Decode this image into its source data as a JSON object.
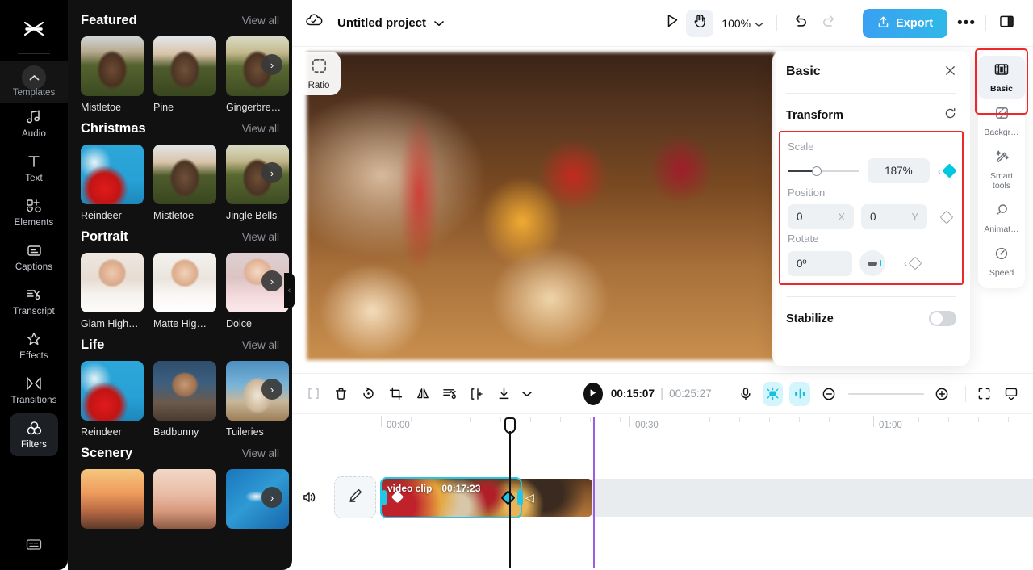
{
  "left_rail": {
    "logo_name": "capcut-logo",
    "templates": {
      "label": "Templates",
      "icon": "chevron-up-icon"
    },
    "items": [
      {
        "label": "Audio",
        "icon": "music-note-icon",
        "active": false
      },
      {
        "label": "Text",
        "icon": "text-t-icon",
        "active": false
      },
      {
        "label": "Elements",
        "icon": "shapes-plus-icon",
        "active": false
      },
      {
        "label": "Captions",
        "icon": "captions-icon",
        "active": false
      },
      {
        "label": "Transcript",
        "icon": "transcript-scissors-icon",
        "active": false
      },
      {
        "label": "Effects",
        "icon": "sparkle-star-icon",
        "active": false
      },
      {
        "label": "Transitions",
        "icon": "transitions-icon",
        "active": false
      },
      {
        "label": "Filters",
        "icon": "filters-circles-icon",
        "active": true
      }
    ],
    "bottom_icon": "keyboard-shortcuts-icon"
  },
  "templates_panel": {
    "view_all_label": "View all",
    "sections": [
      {
        "title": "Featured",
        "cards": [
          {
            "label": "Mistletoe",
            "art": "art-woman"
          },
          {
            "label": "Pine",
            "art": "art-woman2"
          },
          {
            "label": "Gingerbre…",
            "art": "art-woman3"
          }
        ]
      },
      {
        "title": "Christmas",
        "cards": [
          {
            "label": "Reindeer",
            "art": "art-santa"
          },
          {
            "label": "Mistletoe",
            "art": "art-woman2"
          },
          {
            "label": "Jingle Bells",
            "art": "art-woman3"
          }
        ]
      },
      {
        "title": "Portrait",
        "cards": [
          {
            "label": "Glam High…",
            "art": "art-glam"
          },
          {
            "label": "Matte Hig…",
            "art": "art-matte"
          },
          {
            "label": "Dolce",
            "art": "art-dolce"
          }
        ]
      },
      {
        "title": "Life",
        "cards": [
          {
            "label": "Reindeer",
            "art": "art-santa"
          },
          {
            "label": "Badbunny",
            "art": "art-badbunny"
          },
          {
            "label": "Tuileries",
            "art": "art-tuileries"
          }
        ]
      },
      {
        "title": "Scenery",
        "cards": [
          {
            "label": "",
            "art": "art-sunset"
          },
          {
            "label": "",
            "art": "art-tower"
          },
          {
            "label": "",
            "art": "art-pool"
          }
        ]
      }
    ]
  },
  "topbar": {
    "cloud_icon": "cloud-check-icon",
    "project_title": "Untitled project",
    "project_caret": "chevron-down-icon",
    "select_tool_icon": "cursor-arrow-icon",
    "hand_tool_icon": "hand-icon",
    "zoom_level": "100%",
    "undo_icon": "undo-icon",
    "redo_icon": "redo-icon",
    "export_label": "Export",
    "export_icon": "upload-icon",
    "more_label": "•••",
    "layout_icon": "split-layout-icon",
    "accent_color": "#2fb8e8"
  },
  "stage": {
    "ratio_label": "Ratio",
    "ratio_icon": "crop-dashed-icon",
    "collapse_icon": "chevron-left-icon"
  },
  "properties": {
    "title": "Basic",
    "close_icon": "close-icon",
    "transform_label": "Transform",
    "reset_icon": "reset-arrow-icon",
    "scale": {
      "label": "Scale",
      "value": "187%",
      "keyframe": "filled-diamond-icon",
      "prev_icon": "chevron-left-icon"
    },
    "position": {
      "label": "Position",
      "x_value": "0",
      "x_axis": "X",
      "y_value": "0",
      "y_axis": "Y",
      "keyframe": "outline-diamond-icon"
    },
    "rotate": {
      "label": "Rotate",
      "value": "0º",
      "dial_icon": "rotate-dial-icon",
      "keyframe": "outline-diamond-icon",
      "prev_icon": "chevron-left-icon"
    },
    "stabilize": {
      "label": "Stabilize",
      "enabled": false
    },
    "highlight_color": "#f0272a",
    "keyframe_active_color": "#00c8e0"
  },
  "right_rail": {
    "items": [
      {
        "label": "Basic",
        "icon": "film-strip-icon",
        "selected": true
      },
      {
        "label": "Backgr…",
        "icon": "background-hatch-icon",
        "selected": false
      },
      {
        "label": "Smart tools",
        "icon": "magic-wand-icon",
        "selected": false
      },
      {
        "label": "Animat…",
        "icon": "animation-circles-icon",
        "selected": false
      },
      {
        "label": "Speed",
        "icon": "speedometer-icon",
        "selected": false
      }
    ]
  },
  "timeline_toolbar": {
    "tools": [
      {
        "icon": "split-brackets-icon",
        "name": "select-range"
      },
      {
        "icon": "trash-icon",
        "name": "delete"
      },
      {
        "icon": "rotate-clockwise-icon",
        "name": "rotate"
      },
      {
        "icon": "crop-icon",
        "name": "crop"
      },
      {
        "icon": "mirror-icon",
        "name": "mirror"
      },
      {
        "icon": "cut-lines-icon",
        "name": "cut"
      },
      {
        "icon": "split-clip-icon",
        "name": "split"
      },
      {
        "icon": "download-icon",
        "name": "download"
      },
      {
        "icon": "chevron-down-icon",
        "name": "download-more"
      }
    ],
    "play_icon": "play-icon",
    "current_time": "00:15:07",
    "time_separator": "|",
    "total_time": "00:25:27",
    "mic_icon": "microphone-icon",
    "autocut_icon": "auto-cut-icon",
    "audio_split_icon": "audio-split-icon",
    "zoom_out_icon": "minus-circle-icon",
    "zoom_in_icon": "plus-circle-icon",
    "fit_icon": "fit-screen-icon",
    "monitor_icon": "monitor-icon",
    "highlight_color": "#d4f5fb"
  },
  "timeline": {
    "ruler_labels": [
      "00:00",
      "00:30",
      "01:00"
    ],
    "audio_icon": "speaker-icon",
    "edit_icon": "pencil-edit-icon",
    "clip": {
      "name": "video clip",
      "duration": "00:17:23",
      "selected": true,
      "selection_color": "#22c6e8",
      "keyframes": [
        "white-diamond",
        "cyan-diamond"
      ],
      "trim_icon": "trim-arrow-icon"
    },
    "playhead_color": "#111111",
    "marker_color": "#9b5de5"
  }
}
